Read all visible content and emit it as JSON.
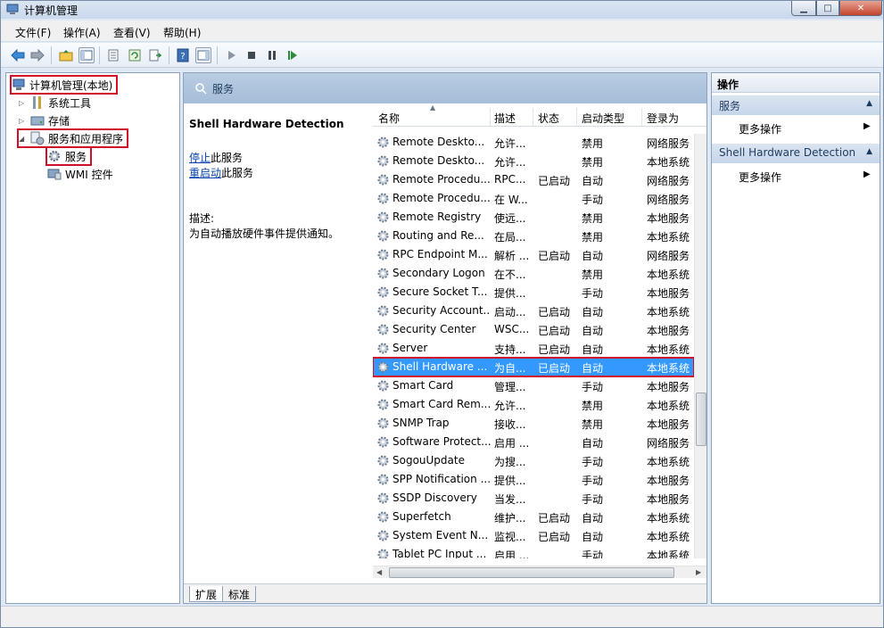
{
  "window": {
    "title": "计算机管理"
  },
  "menu": [
    "文件(F)",
    "操作(A)",
    "查看(V)",
    "帮助(H)"
  ],
  "tree": {
    "root": "计算机管理(本地)",
    "system_tools": "系统工具",
    "storage": "存储",
    "services_apps": "服务和应用程序",
    "services": "服务",
    "wmi": "WMI 控件"
  },
  "pane_header": "服务",
  "detail": {
    "service_name": "Shell Hardware Detection",
    "stop_link": "停止",
    "stop_suffix": "此服务",
    "restart_link": "重启动",
    "restart_suffix": "此服务",
    "desc_label": "描述:",
    "desc_text": "为自动播放硬件事件提供通知。"
  },
  "columns": [
    "名称",
    "描述",
    "状态",
    "启动类型",
    "登录为"
  ],
  "rows": [
    [
      "Remote Deskto...",
      "允许...",
      "",
      "禁用",
      "网络服务"
    ],
    [
      "Remote Deskto...",
      "允许...",
      "",
      "禁用",
      "本地系统"
    ],
    [
      "Remote Procedu...",
      "RPC...",
      "已启动",
      "自动",
      "网络服务"
    ],
    [
      "Remote Procedu...",
      "在 W...",
      "",
      "手动",
      "网络服务"
    ],
    [
      "Remote Registry",
      "使远...",
      "",
      "禁用",
      "本地服务"
    ],
    [
      "Routing and Re...",
      "在局...",
      "",
      "禁用",
      "本地系统"
    ],
    [
      "RPC Endpoint M...",
      "解析 ...",
      "已启动",
      "自动",
      "网络服务"
    ],
    [
      "Secondary Logon",
      "在不...",
      "",
      "禁用",
      "本地系统"
    ],
    [
      "Secure Socket T...",
      "提供...",
      "",
      "手动",
      "本地服务"
    ],
    [
      "Security Account...",
      "启动...",
      "已启动",
      "自动",
      "本地系统"
    ],
    [
      "Security Center",
      "WSC...",
      "已启动",
      "自动",
      "本地服务"
    ],
    [
      "Server",
      "支持...",
      "已启动",
      "自动",
      "本地系统"
    ],
    [
      "Shell Hardware ...",
      "为自...",
      "已启动",
      "自动",
      "本地系统"
    ],
    [
      "Smart Card",
      "管理...",
      "",
      "手动",
      "本地服务"
    ],
    [
      "Smart Card Rem...",
      "允许...",
      "",
      "禁用",
      "本地系统"
    ],
    [
      "SNMP Trap",
      "接收...",
      "",
      "禁用",
      "本地服务"
    ],
    [
      "Software Protect...",
      "启用 ...",
      "",
      "自动",
      "网络服务"
    ],
    [
      "SogouUpdate",
      "为搜...",
      "",
      "手动",
      "本地系统"
    ],
    [
      "SPP Notification ...",
      "提供...",
      "",
      "手动",
      "本地服务"
    ],
    [
      "SSDP Discovery",
      "当发...",
      "",
      "手动",
      "本地服务"
    ],
    [
      "Superfetch",
      "维护...",
      "已启动",
      "自动",
      "本地系统"
    ],
    [
      "System Event N...",
      "监视...",
      "已启动",
      "自动",
      "本地系统"
    ],
    [
      "Tablet PC Input ...",
      "启用 ...",
      "",
      "手动",
      "本地系统"
    ]
  ],
  "selected_row": 12,
  "tabs": [
    "扩展",
    "标准"
  ],
  "actions": {
    "title": "操作",
    "section1": "服务",
    "item1": "更多操作",
    "section2": "Shell Hardware Detection",
    "item2": "更多操作"
  },
  "icons": {
    "nav": [
      "back-arrow-icon",
      "forward-arrow-icon",
      "up-folder-icon",
      "show-hide-tree-icon",
      "properties-icon",
      "refresh-icon",
      "export-list-icon",
      "help-icon",
      "show-hide-action-icon",
      "play-icon",
      "stop-icon",
      "pause-icon",
      "resume-icon"
    ]
  },
  "colors": {
    "selection": "#3399ff",
    "highlight_box": "#d0102b",
    "header_bg": "#a5bdd8"
  }
}
